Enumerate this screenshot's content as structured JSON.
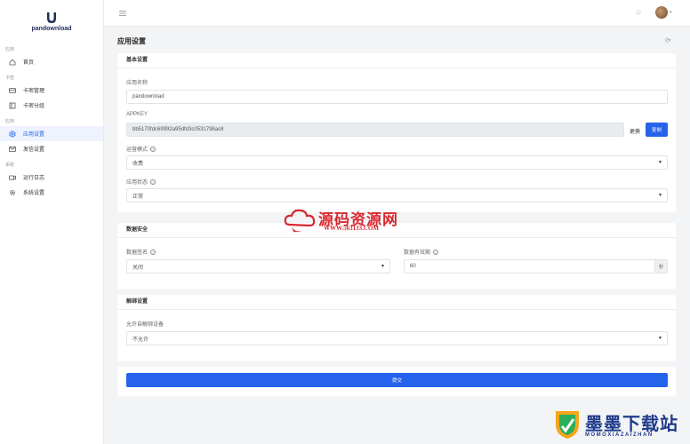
{
  "brand": {
    "name": "pandownload"
  },
  "sidebar": {
    "groups": [
      {
        "label": "应用",
        "items": [
          {
            "label": "首页",
            "icon": "home-icon"
          }
        ]
      },
      {
        "label": "卡密",
        "items": [
          {
            "label": "卡密管理",
            "icon": "card-icon"
          },
          {
            "label": "卡密分组",
            "icon": "group-icon"
          }
        ]
      },
      {
        "label": "应用",
        "items": [
          {
            "label": "应用设置",
            "icon": "settings-icon"
          },
          {
            "label": "发信设置",
            "icon": "mail-icon"
          }
        ]
      },
      {
        "label": "系统",
        "items": [
          {
            "label": "运行日志",
            "icon": "log-icon"
          },
          {
            "label": "系统设置",
            "icon": "gear-icon"
          }
        ]
      }
    ],
    "active": "应用设置"
  },
  "page": {
    "title": "应用设置"
  },
  "basic": {
    "title": "基本设置",
    "app_name_label": "应用名称",
    "app_name_value": "pandownload",
    "appkey_label": "APPKEY",
    "appkey_value": "bb5170fdc69992a95dfd3c0531798ac8",
    "replace_label": "更换",
    "copy_label": "复制",
    "mode_label": "运营模式",
    "mode_value": "收费",
    "status_label": "应用状态",
    "status_value": "正常"
  },
  "security": {
    "title": "数据安全",
    "sign_label": "数据签名",
    "sign_value": "关闭",
    "validity_label": "数据有效期",
    "validity_value": "60",
    "validity_unit": "秒"
  },
  "unbind": {
    "title": "解绑设置",
    "allow_label": "允许自解绑设备",
    "allow_value": "不允许"
  },
  "submit_label": "提交",
  "watermarks": {
    "site1_cn": "源码资源网",
    "site1_url": "WWW.563133.COM",
    "site2_cn": "墨墨下载站",
    "site2_en": "MOMOXIAZAIZHAN"
  },
  "colors": {
    "primary": "#2563eb",
    "watermark_red": "#d9282f",
    "watermark_blue": "#1f3b8a"
  }
}
